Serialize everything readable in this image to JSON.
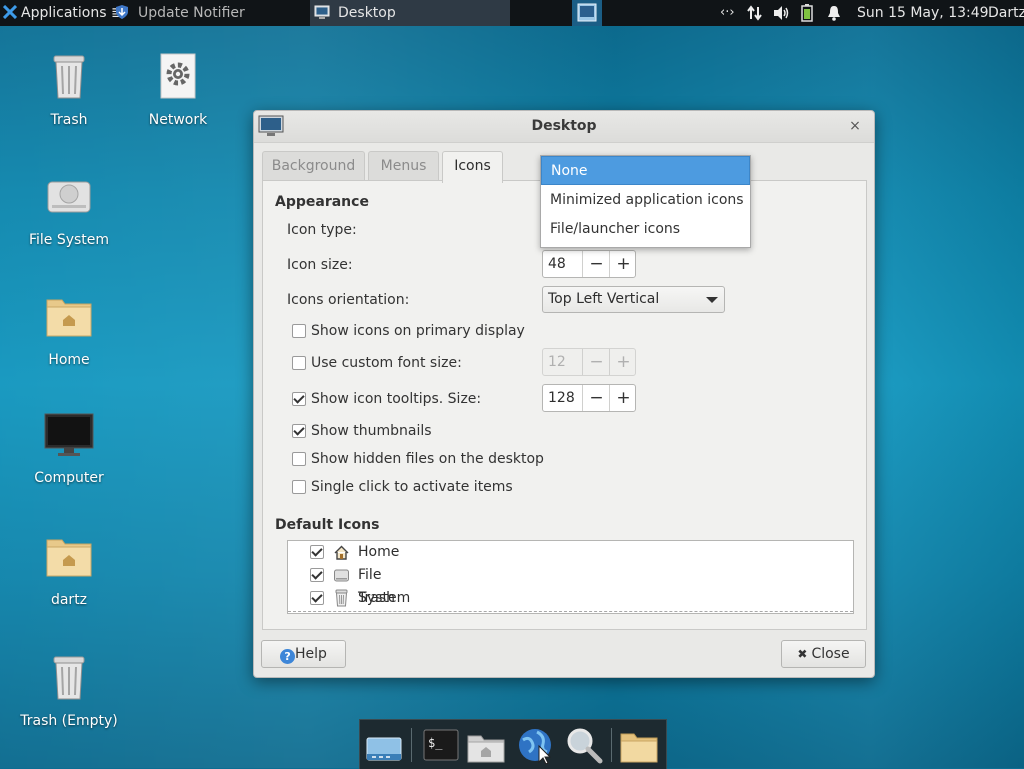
{
  "panel": {
    "applications": "Applications",
    "applications_suffix": "≣",
    "tasks": [
      {
        "label": "Update Notifier"
      },
      {
        "label": "Desktop"
      }
    ],
    "network_indicator": "‹·›",
    "clock": "Sun 15 May, 13:49",
    "user": "Dartz"
  },
  "desktop_icons": [
    {
      "label": "Trash"
    },
    {
      "label": "Network"
    },
    {
      "label": "File System"
    },
    {
      "label": "Home"
    },
    {
      "label": "Computer"
    },
    {
      "label": "dartz"
    },
    {
      "label": "Trash (Empty)"
    }
  ],
  "window": {
    "title": "Desktop",
    "close_glyph": "×",
    "tabs": [
      "Background",
      "Menus",
      "Icons"
    ],
    "active_tab": "Icons",
    "appearance": {
      "heading": "Appearance",
      "icon_type_label": "Icon type:",
      "icon_size_label": "Icon size:",
      "icon_size_value": "48",
      "orientation_label": "Icons orientation:",
      "orientation_value": "Top Left Vertical",
      "options": [
        {
          "label": "Show icons on primary display",
          "checked": false
        },
        {
          "label": "Use custom font size:",
          "checked": false
        },
        {
          "label": "Show icon tooltips. Size:",
          "checked": true
        },
        {
          "label": "Show thumbnails",
          "checked": true
        },
        {
          "label": "Show hidden files on the desktop",
          "checked": false
        },
        {
          "label": "Single click to activate items",
          "checked": false
        }
      ],
      "custom_font_size_value": "12",
      "tooltip_size_value": "128",
      "minus": "−",
      "plus": "+"
    },
    "default_icons": {
      "heading": "Default Icons",
      "items": [
        {
          "label": "Home",
          "checked": true,
          "icon": "home-icon"
        },
        {
          "label": "File System",
          "checked": true,
          "icon": "drive-icon"
        },
        {
          "label": "Trash",
          "checked": true,
          "icon": "trash-icon"
        }
      ]
    },
    "help_label": "Help",
    "help_glyph": "?",
    "close_label": "Close",
    "close_button_glyph": "✖"
  },
  "icon_type_dropdown": {
    "options": [
      "None",
      "Minimized application icons",
      "File/launcher icons"
    ],
    "selected": "None"
  },
  "colors": {
    "selection": "#4d9be0",
    "panel": "#101417",
    "desktop": "#1397bf"
  }
}
